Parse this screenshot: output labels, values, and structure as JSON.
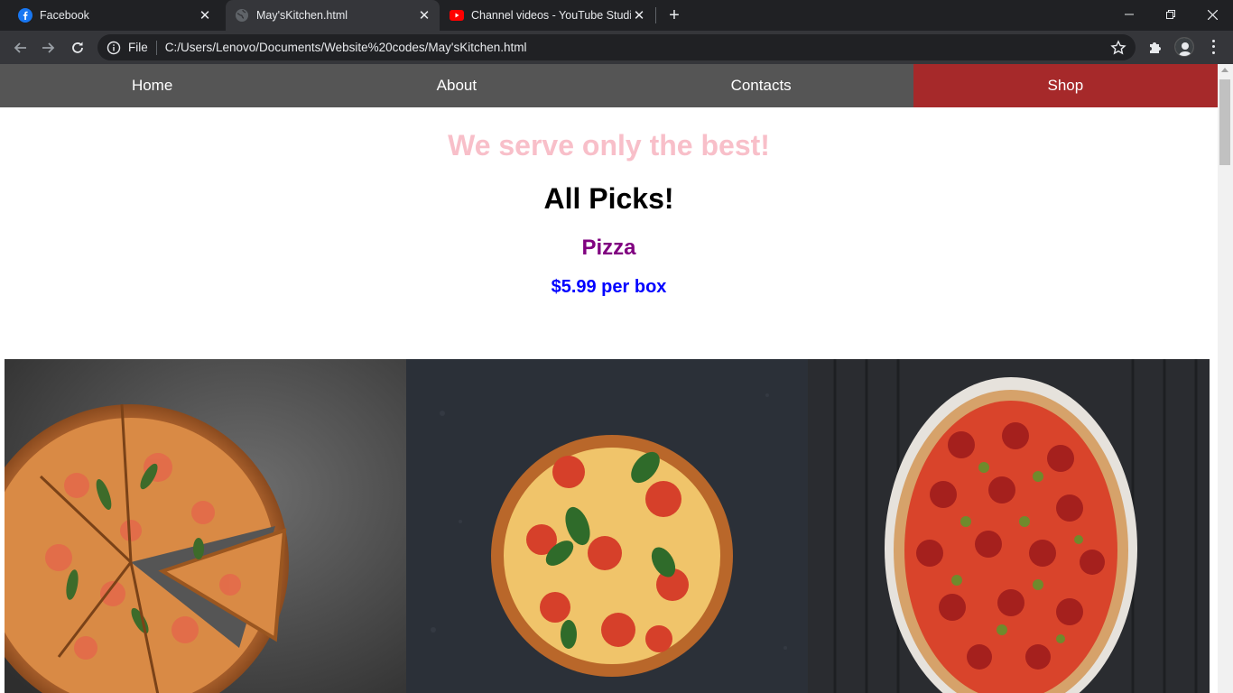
{
  "browser": {
    "tabs": [
      {
        "title": "Facebook",
        "icon": "facebook-icon",
        "active": false
      },
      {
        "title": "May'sKitchen.html",
        "icon": "globe-icon",
        "active": true
      },
      {
        "title": "Channel videos - YouTube Studio",
        "icon": "youtube-icon",
        "active": false
      }
    ],
    "omnibox": {
      "scheme_label": "File",
      "url": "C:/Users/Lenovo/Documents/Website%20codes/May'sKitchen.html"
    }
  },
  "site": {
    "nav": [
      {
        "label": "Home"
      },
      {
        "label": "About"
      },
      {
        "label": "Contacts"
      },
      {
        "label": "Shop",
        "active": true
      }
    ],
    "tagline": "We serve only the best!",
    "heading": "All Picks!",
    "product_name": "Pizza",
    "product_price": "$5.99 per box",
    "gallery": [
      {
        "alt": "sliced pizza with basil on dark background"
      },
      {
        "alt": "margherita pizza with tomato and basil"
      },
      {
        "alt": "pepperoni pizza on white plate"
      }
    ]
  },
  "colors": {
    "nav_bg": "#555555",
    "shop_bg": "#a6292a",
    "tagline": "#f8bfc9",
    "product": "#800080",
    "price": "#0000ff"
  }
}
